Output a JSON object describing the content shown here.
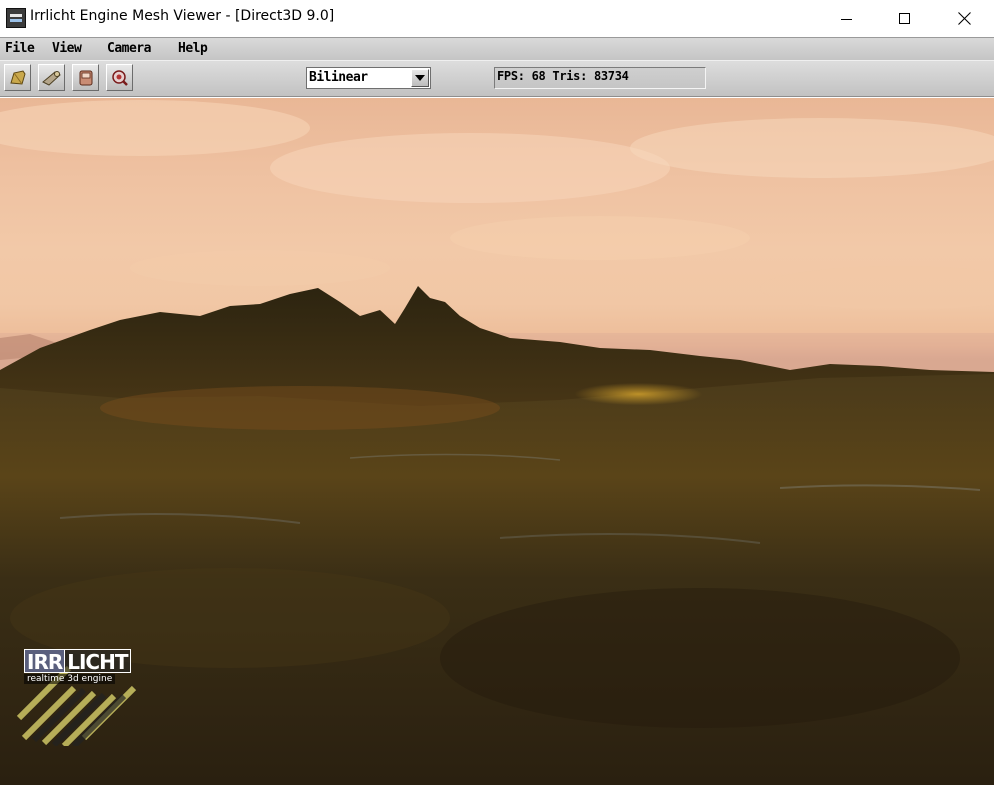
{
  "window": {
    "title": "Irrlicht Engine Mesh Viewer - [Direct3D 9.0]",
    "icon": "irrlicht-app-icon"
  },
  "menu": {
    "items": [
      {
        "label": "File"
      },
      {
        "label": "View"
      },
      {
        "label": "Camera"
      },
      {
        "label": "Help"
      }
    ]
  },
  "toolbar": {
    "buttons": [
      {
        "icon": "open-file-icon"
      },
      {
        "icon": "set-path-icon"
      },
      {
        "icon": "save-icon"
      },
      {
        "icon": "help-icon"
      }
    ],
    "filter_select": {
      "value": "Bilinear"
    },
    "status": "FPS: 68 Tris: 83734"
  },
  "viewport": {
    "scene": "terrain-with-skybox",
    "logo": {
      "word_a": "IRR",
      "word_b": "LICHT",
      "tagline": "realtime 3d engine"
    }
  },
  "colors": {
    "sky": "#f0c4a3",
    "terrain": "#3a2e16",
    "menubar": "#d0d0d0"
  }
}
